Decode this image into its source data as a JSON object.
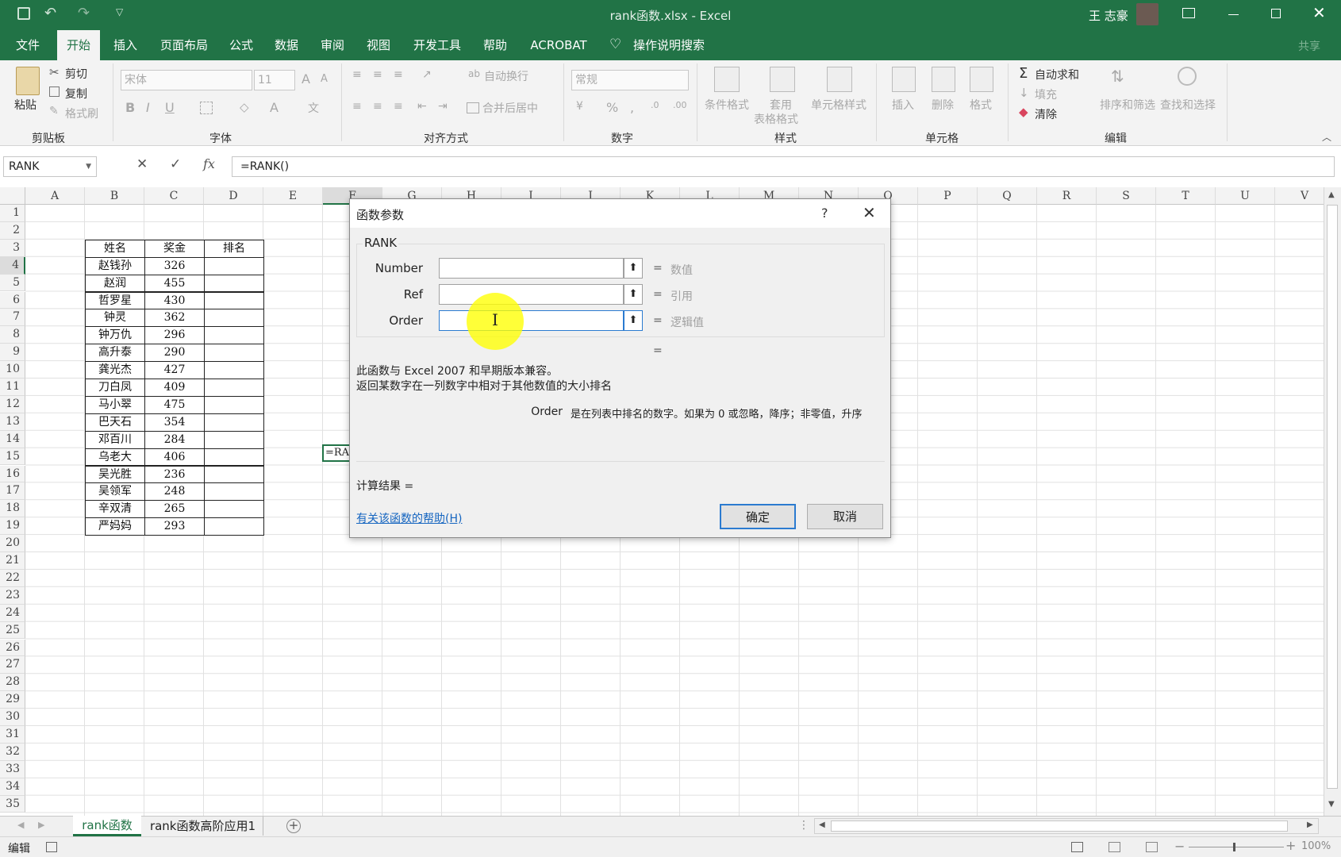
{
  "window": {
    "title": "rank函数.xlsx  -  Excel",
    "user": "王 志豪"
  },
  "menu": {
    "tabs": [
      "文件",
      "开始",
      "插入",
      "页面布局",
      "公式",
      "数据",
      "审阅",
      "视图",
      "开发工具",
      "帮助",
      "ACROBAT"
    ],
    "active": "开始",
    "search": "操作说明搜索",
    "share": "共享"
  },
  "ribbon": {
    "clipboard": {
      "paste": "粘贴",
      "cut": "剪切",
      "copy": "复制",
      "format_painter": "格式刷",
      "label": "剪贴板"
    },
    "font": {
      "name": "宋体",
      "size": "11",
      "label": "字体"
    },
    "align": {
      "wrap": "自动换行",
      "merge": "合并后居中",
      "label": "对齐方式"
    },
    "number": {
      "format": "常规",
      "label": "数字"
    },
    "styles": {
      "cond": "条件格式",
      "table1": "套用",
      "table2": "表格格式",
      "cell": "单元格样式",
      "label": "样式"
    },
    "cells": {
      "insert": "插入",
      "delete": "删除",
      "format": "格式",
      "label": "单元格"
    },
    "editing": {
      "autosum": "自动求和",
      "fill": "填充",
      "clear": "清除",
      "sort": "排序和筛选",
      "find": "查找和选择",
      "label": "编辑"
    }
  },
  "formula_bar": {
    "name_box": "RANK",
    "formula": "=RANK()"
  },
  "grid": {
    "columns": [
      "A",
      "B",
      "C",
      "D",
      "E",
      "F",
      "G",
      "H",
      "I",
      "J",
      "K",
      "L",
      "M",
      "N",
      "O",
      "P",
      "Q",
      "R",
      "S",
      "T",
      "U",
      "V"
    ],
    "rows": [
      "1",
      "2",
      "3",
      "4",
      "5",
      "6",
      "7",
      "8",
      "9",
      "10",
      "11",
      "12",
      "13",
      "14",
      "15",
      "16",
      "17",
      "18",
      "19",
      "20",
      "21",
      "22",
      "23",
      "24",
      "25",
      "26",
      "27",
      "28",
      "29",
      "30",
      "31",
      "32",
      "33",
      "34",
      "35"
    ],
    "table_headers": [
      "姓名",
      "奖金",
      "排名"
    ],
    "table_rows": [
      [
        "赵钱孙",
        "326"
      ],
      [
        "赵润",
        "455"
      ],
      [
        "哲罗星",
        "430"
      ],
      [
        "钟灵",
        "362"
      ],
      [
        "钟万仇",
        "296"
      ],
      [
        "高升泰",
        "290"
      ],
      [
        "龚光杰",
        "427"
      ],
      [
        "刀白凤",
        "409"
      ],
      [
        "马小翠",
        "475"
      ],
      [
        "巴天石",
        "354"
      ],
      [
        "邓百川",
        "284"
      ],
      [
        "乌老大",
        "406"
      ],
      [
        "吴光胜",
        "236"
      ],
      [
        "吴领军",
        "248"
      ],
      [
        "辛双清",
        "265"
      ],
      [
        "严妈妈",
        "293"
      ]
    ],
    "active_cell_text": "=RAN"
  },
  "dialog": {
    "title": "函数参数",
    "help_q": "?",
    "function_name": "RANK",
    "args": [
      {
        "label": "Number",
        "value": "数值"
      },
      {
        "label": "Ref",
        "value": "引用"
      },
      {
        "label": "Order",
        "value": "逻辑值"
      }
    ],
    "result_eq": "=",
    "desc1": "此函数与 Excel 2007 和早期版本兼容。",
    "desc2": "返回某数字在一列数字中相对于其他数值的大小排名",
    "arg_help_name": "Order",
    "arg_help_text": "是在列表中排名的数字。如果为 0 或忽略，降序；非零值，升序",
    "calc_result": "计算结果 =",
    "help_link": "有关该函数的帮助(H)",
    "ok": "确定",
    "cancel": "取消"
  },
  "sheets": {
    "tabs": [
      "rank函数",
      "rank函数高阶应用1"
    ],
    "active": "rank函数"
  },
  "status": {
    "mode": "编辑",
    "zoom": "100%"
  },
  "colors": {
    "excel_green": "#217346",
    "highlight": "#ffff00"
  }
}
